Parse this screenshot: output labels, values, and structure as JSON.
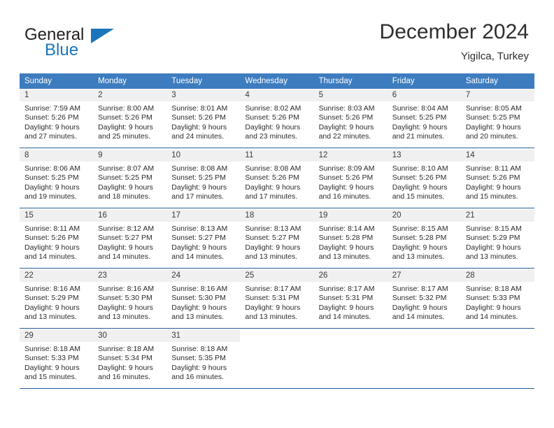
{
  "brand": {
    "word_one": "General",
    "word_two": "Blue",
    "triangle_icon": "brand-triangle-icon"
  },
  "header": {
    "month_title": "December 2024",
    "location": "Yigilca, Turkey"
  },
  "colors": {
    "header_blue": "#3d7cbf",
    "rule_blue": "#2a6099",
    "brand_blue": "#1b75bb",
    "daynum_bg": "#f0f0f0",
    "text": "#2b2b2b"
  },
  "weekday_headers": [
    "Sunday",
    "Monday",
    "Tuesday",
    "Wednesday",
    "Thursday",
    "Friday",
    "Saturday"
  ],
  "weeks": [
    [
      {
        "day": "1",
        "sunrise": "Sunrise: 7:59 AM",
        "sunset": "Sunset: 5:26 PM",
        "daylight1": "Daylight: 9 hours",
        "daylight2": "and 27 minutes."
      },
      {
        "day": "2",
        "sunrise": "Sunrise: 8:00 AM",
        "sunset": "Sunset: 5:26 PM",
        "daylight1": "Daylight: 9 hours",
        "daylight2": "and 25 minutes."
      },
      {
        "day": "3",
        "sunrise": "Sunrise: 8:01 AM",
        "sunset": "Sunset: 5:26 PM",
        "daylight1": "Daylight: 9 hours",
        "daylight2": "and 24 minutes."
      },
      {
        "day": "4",
        "sunrise": "Sunrise: 8:02 AM",
        "sunset": "Sunset: 5:26 PM",
        "daylight1": "Daylight: 9 hours",
        "daylight2": "and 23 minutes."
      },
      {
        "day": "5",
        "sunrise": "Sunrise: 8:03 AM",
        "sunset": "Sunset: 5:26 PM",
        "daylight1": "Daylight: 9 hours",
        "daylight2": "and 22 minutes."
      },
      {
        "day": "6",
        "sunrise": "Sunrise: 8:04 AM",
        "sunset": "Sunset: 5:25 PM",
        "daylight1": "Daylight: 9 hours",
        "daylight2": "and 21 minutes."
      },
      {
        "day": "7",
        "sunrise": "Sunrise: 8:05 AM",
        "sunset": "Sunset: 5:25 PM",
        "daylight1": "Daylight: 9 hours",
        "daylight2": "and 20 minutes."
      }
    ],
    [
      {
        "day": "8",
        "sunrise": "Sunrise: 8:06 AM",
        "sunset": "Sunset: 5:25 PM",
        "daylight1": "Daylight: 9 hours",
        "daylight2": "and 19 minutes."
      },
      {
        "day": "9",
        "sunrise": "Sunrise: 8:07 AM",
        "sunset": "Sunset: 5:25 PM",
        "daylight1": "Daylight: 9 hours",
        "daylight2": "and 18 minutes."
      },
      {
        "day": "10",
        "sunrise": "Sunrise: 8:08 AM",
        "sunset": "Sunset: 5:25 PM",
        "daylight1": "Daylight: 9 hours",
        "daylight2": "and 17 minutes."
      },
      {
        "day": "11",
        "sunrise": "Sunrise: 8:08 AM",
        "sunset": "Sunset: 5:26 PM",
        "daylight1": "Daylight: 9 hours",
        "daylight2": "and 17 minutes."
      },
      {
        "day": "12",
        "sunrise": "Sunrise: 8:09 AM",
        "sunset": "Sunset: 5:26 PM",
        "daylight1": "Daylight: 9 hours",
        "daylight2": "and 16 minutes."
      },
      {
        "day": "13",
        "sunrise": "Sunrise: 8:10 AM",
        "sunset": "Sunset: 5:26 PM",
        "daylight1": "Daylight: 9 hours",
        "daylight2": "and 15 minutes."
      },
      {
        "day": "14",
        "sunrise": "Sunrise: 8:11 AM",
        "sunset": "Sunset: 5:26 PM",
        "daylight1": "Daylight: 9 hours",
        "daylight2": "and 15 minutes."
      }
    ],
    [
      {
        "day": "15",
        "sunrise": "Sunrise: 8:11 AM",
        "sunset": "Sunset: 5:26 PM",
        "daylight1": "Daylight: 9 hours",
        "daylight2": "and 14 minutes."
      },
      {
        "day": "16",
        "sunrise": "Sunrise: 8:12 AM",
        "sunset": "Sunset: 5:27 PM",
        "daylight1": "Daylight: 9 hours",
        "daylight2": "and 14 minutes."
      },
      {
        "day": "17",
        "sunrise": "Sunrise: 8:13 AM",
        "sunset": "Sunset: 5:27 PM",
        "daylight1": "Daylight: 9 hours",
        "daylight2": "and 14 minutes."
      },
      {
        "day": "18",
        "sunrise": "Sunrise: 8:13 AM",
        "sunset": "Sunset: 5:27 PM",
        "daylight1": "Daylight: 9 hours",
        "daylight2": "and 13 minutes."
      },
      {
        "day": "19",
        "sunrise": "Sunrise: 8:14 AM",
        "sunset": "Sunset: 5:28 PM",
        "daylight1": "Daylight: 9 hours",
        "daylight2": "and 13 minutes."
      },
      {
        "day": "20",
        "sunrise": "Sunrise: 8:15 AM",
        "sunset": "Sunset: 5:28 PM",
        "daylight1": "Daylight: 9 hours",
        "daylight2": "and 13 minutes."
      },
      {
        "day": "21",
        "sunrise": "Sunrise: 8:15 AM",
        "sunset": "Sunset: 5:29 PM",
        "daylight1": "Daylight: 9 hours",
        "daylight2": "and 13 minutes."
      }
    ],
    [
      {
        "day": "22",
        "sunrise": "Sunrise: 8:16 AM",
        "sunset": "Sunset: 5:29 PM",
        "daylight1": "Daylight: 9 hours",
        "daylight2": "and 13 minutes."
      },
      {
        "day": "23",
        "sunrise": "Sunrise: 8:16 AM",
        "sunset": "Sunset: 5:30 PM",
        "daylight1": "Daylight: 9 hours",
        "daylight2": "and 13 minutes."
      },
      {
        "day": "24",
        "sunrise": "Sunrise: 8:16 AM",
        "sunset": "Sunset: 5:30 PM",
        "daylight1": "Daylight: 9 hours",
        "daylight2": "and 13 minutes."
      },
      {
        "day": "25",
        "sunrise": "Sunrise: 8:17 AM",
        "sunset": "Sunset: 5:31 PM",
        "daylight1": "Daylight: 9 hours",
        "daylight2": "and 13 minutes."
      },
      {
        "day": "26",
        "sunrise": "Sunrise: 8:17 AM",
        "sunset": "Sunset: 5:31 PM",
        "daylight1": "Daylight: 9 hours",
        "daylight2": "and 14 minutes."
      },
      {
        "day": "27",
        "sunrise": "Sunrise: 8:17 AM",
        "sunset": "Sunset: 5:32 PM",
        "daylight1": "Daylight: 9 hours",
        "daylight2": "and 14 minutes."
      },
      {
        "day": "28",
        "sunrise": "Sunrise: 8:18 AM",
        "sunset": "Sunset: 5:33 PM",
        "daylight1": "Daylight: 9 hours",
        "daylight2": "and 14 minutes."
      }
    ],
    [
      {
        "day": "29",
        "sunrise": "Sunrise: 8:18 AM",
        "sunset": "Sunset: 5:33 PM",
        "daylight1": "Daylight: 9 hours",
        "daylight2": "and 15 minutes."
      },
      {
        "day": "30",
        "sunrise": "Sunrise: 8:18 AM",
        "sunset": "Sunset: 5:34 PM",
        "daylight1": "Daylight: 9 hours",
        "daylight2": "and 16 minutes."
      },
      {
        "day": "31",
        "sunrise": "Sunrise: 8:18 AM",
        "sunset": "Sunset: 5:35 PM",
        "daylight1": "Daylight: 9 hours",
        "daylight2": "and 16 minutes."
      },
      {
        "day": "",
        "sunrise": "",
        "sunset": "",
        "daylight1": "",
        "daylight2": ""
      },
      {
        "day": "",
        "sunrise": "",
        "sunset": "",
        "daylight1": "",
        "daylight2": ""
      },
      {
        "day": "",
        "sunrise": "",
        "sunset": "",
        "daylight1": "",
        "daylight2": ""
      },
      {
        "day": "",
        "sunrise": "",
        "sunset": "",
        "daylight1": "",
        "daylight2": ""
      }
    ]
  ]
}
